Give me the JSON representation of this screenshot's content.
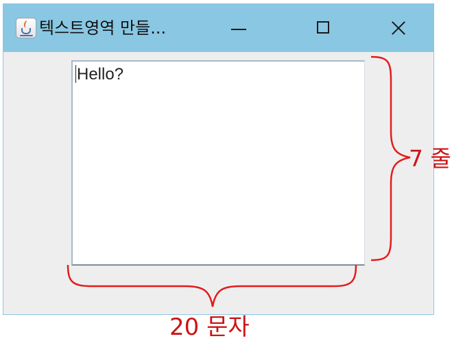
{
  "window": {
    "title": "텍스트영역 만들...",
    "controls": {
      "minimize": "minimize",
      "maximize": "maximize",
      "close": "close"
    }
  },
  "textarea": {
    "value": "Hello?"
  },
  "annotations": {
    "rows_label": "7 줄",
    "columns_label": "20 문자",
    "color": "#cc1414"
  },
  "colors": {
    "titlebar": "#89c7e3",
    "window_bg": "#eeeeee",
    "annotation": "#cc1414"
  }
}
